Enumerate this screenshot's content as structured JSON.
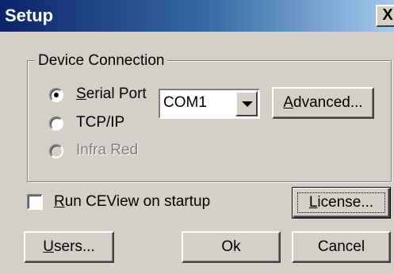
{
  "window": {
    "title": "Setup",
    "close_glyph": "X"
  },
  "device_connection": {
    "legend": "Device Connection",
    "options": [
      {
        "mnemonic": "S",
        "rest": "erial Port",
        "selected": true,
        "enabled": true
      },
      {
        "mnemonic": "",
        "rest": "TCP/IP",
        "selected": false,
        "enabled": true
      },
      {
        "mnemonic": "",
        "rest": "Infra Red",
        "selected": false,
        "enabled": false
      }
    ],
    "port_select": {
      "value": "COM1"
    },
    "advanced_button": {
      "mnemonic": "A",
      "rest": "dvanced..."
    }
  },
  "startup_checkbox": {
    "mnemonic": "R",
    "rest": "un CEView on startup",
    "checked": false
  },
  "buttons": {
    "license": {
      "mnemonic": "L",
      "rest": "icense..."
    },
    "users": {
      "mnemonic": "U",
      "rest": "sers..."
    },
    "ok": {
      "label": "Ok"
    },
    "cancel": {
      "label": "Cancel"
    }
  },
  "colors": {
    "face": "#d4d0c8",
    "title_start": "#0a246a",
    "title_end": "#a6caf0",
    "disabled_text": "#808080"
  }
}
